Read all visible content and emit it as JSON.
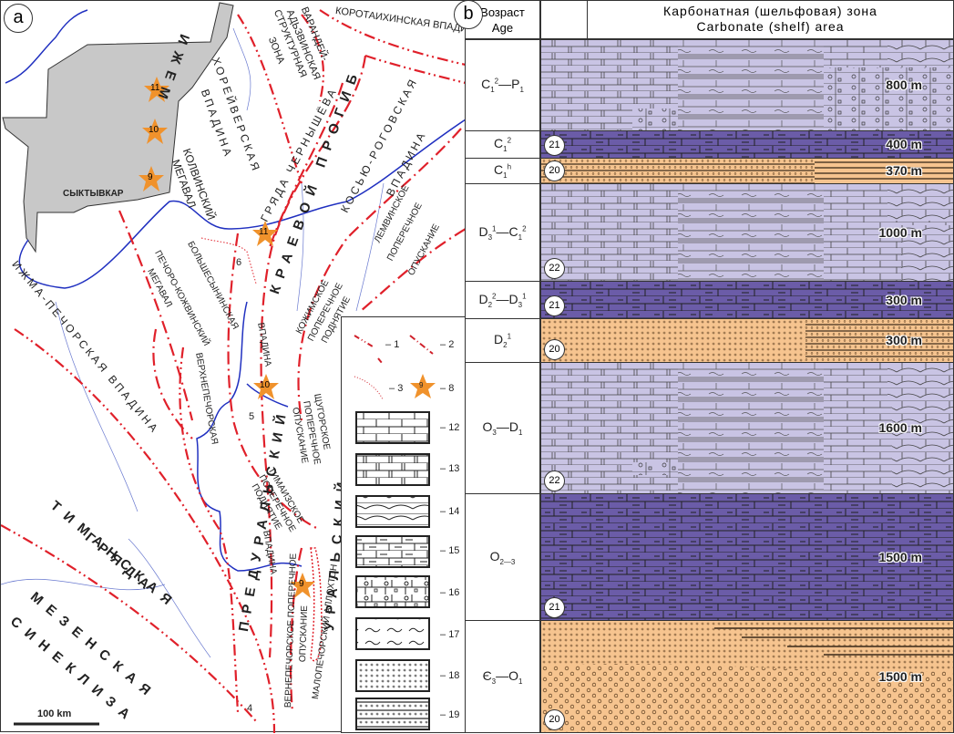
{
  "panel_a": {
    "letter": "a",
    "city": "СЫКТЫВКАР",
    "scale_label": "100 km",
    "stars": [
      "11",
      "10",
      "9",
      "11",
      "10",
      "9"
    ],
    "numbers": [
      "6",
      "5",
      "4"
    ],
    "labels": {
      "korotaikha": "КОРОТАИХИНСКАЯ ВПАДИНА",
      "varandey": "ВАРАНДЕЙ-",
      "adzva": "АДЬЗВИНСКАЯ",
      "struct": "СТРУКТУРНАЯ",
      "zona": "ЗОНА",
      "khoreyver": "ХОРЕЙВЕРСКАЯ",
      "vpadina1": "ВПАДИНА",
      "izhma_letters": "ИЖЕМ",
      "kolva": "КОЛВИНСКИЙ",
      "megaval1": "МЕГАВАЛ",
      "chernyshev": "ГРЯДА ЧЕРНЫШЁВА",
      "kraevoy": "КРАЕВОЙ ПРОГИБ",
      "kosyu": "КОСЬЮ-РОГОВСКАЯ",
      "vpadina2": "ВПАДИНА",
      "lemva": "ЛЕМВИНСКОЕ",
      "poperechnoe1": "ПОПЕРЕЧНОЕ",
      "opuskanie1": "ОПУСКАНИЕ",
      "kozhim": "КОЖИМСКОЕ",
      "poperechnoe2": "ПОПЕРЕЧНОЕ",
      "podnyatie1": "ПОДНЯТИЕ",
      "bolsheshynin": "БОЛЬШЕСЫНИНСКАЯ",
      "vpadina3": "ВПАДИНА",
      "pechoro": "ПЕЧОРО-КОЖВИНСКИЙ",
      "megaval2": "МЕГАВАЛ",
      "izhmapechora": "ИЖМА-ПЕЧОРСКАЯ ВПАДИНА",
      "verkhnepech": "ВЕРХНЕПЕЧОРСКАЯ",
      "preduralsky": "ПРЕДУРАЛЬСКИЙ",
      "uralsky": "УРАЛЬСКИЙ",
      "shchugor": "ЩУГОРСКОЕ",
      "poperechnoe3": "ПОПЕРЕЧНОЕ",
      "opuskanie2": "ОПУСКАНИЕ",
      "timaiz": "ТИМАИЗСКОЕ",
      "poperechnoe4": "ПОПЕРЕЧНОЕ",
      "podnyatie2": "ПОДНЯТИЕ",
      "vpadina4": "ВПАДИНА",
      "verkhnepech2": "ВЕРНЕПЕЧОРСКОЕ ПОПЕРЕЧНОЕ",
      "opuskanie3": "ОПУСКАНИЕ",
      "allochthon": "МАЛОПЕЧОРСКИЙ АЛЛОХТОН",
      "timan": "ТИМАНСКАЯ",
      "gryada": "ГРЯДА",
      "mezen": "МЕЗЕНСКАЯ",
      "sinekliza": "СИНЕКЛИЗА"
    },
    "legend": {
      "items": [
        {
          "num": "1",
          "pattern": "dash-dot-dot red line"
        },
        {
          "num": "2",
          "pattern": "dash-dot red line"
        },
        {
          "num": "3",
          "pattern": "dotted red line"
        },
        {
          "num": "8",
          "pattern": "star",
          "star_label": "9"
        },
        {
          "num": "12",
          "pattern": "limestone"
        },
        {
          "num": "13",
          "pattern": "dolomitic limestone"
        },
        {
          "num": "14",
          "pattern": "reef limestone"
        },
        {
          "num": "15",
          "pattern": "clayey limestone"
        },
        {
          "num": "16",
          "pattern": "breccia limestone"
        },
        {
          "num": "17",
          "pattern": "wavy"
        },
        {
          "num": "18",
          "pattern": "sandstone"
        },
        {
          "num": "19",
          "pattern": "interbedded sandstone"
        }
      ]
    },
    "colors": {
      "region": "#c8c8c8",
      "fault": "#e0202a",
      "river": "#2030c0",
      "star": "#f0922c"
    }
  },
  "panel_b": {
    "letter": "b",
    "age_header": [
      "Возраст",
      "Age"
    ],
    "title": [
      "Карбонатная (шельфовая) зона",
      "Carbonate (shelf) area"
    ],
    "layers": [
      {
        "age_main": "C",
        "age_html": "C<sub>1</sub><sup>2</sup>—P<sub>1</sub>",
        "thickness": "800 m",
        "circle": "",
        "type": "mixed"
      },
      {
        "age_html": "C<sub>1</sub><sup>2</sup>",
        "thickness": "400 m",
        "circle": "21",
        "type": "dark"
      },
      {
        "age_html": "C<sub>1</sub><sup>h</sup>",
        "thickness": "370 m",
        "circle": "20",
        "type": "sand-striped"
      },
      {
        "age_html": "D<sub>3</sub><sup>1</sup>—C<sub>1</sub><sup>2</sup>",
        "thickness": "1000 m",
        "circle": "22",
        "type": "mixed"
      },
      {
        "age_html": "D<sub>2</sub><sup>2</sup>—D<sub>3</sub><sup>1</sup>",
        "thickness": "300 m",
        "circle": "21",
        "type": "dark"
      },
      {
        "age_html": "D<sub>2</sub><sup>1</sup>",
        "thickness": "300 m",
        "circle": "20",
        "type": "sand-right"
      },
      {
        "age_html": "O<sub>3</sub>—D<sub>1</sub>",
        "thickness": "1600 m",
        "circle": "22",
        "type": "mixed"
      },
      {
        "age_html": "O<sub>2—3</sub>",
        "thickness": "1500 m",
        "circle": "21",
        "type": "dark"
      },
      {
        "age_html": "Є<sub>3</sub>—O<sub>1</sub>",
        "thickness": "1500 m",
        "circle": "20",
        "type": "sand-coarse"
      }
    ],
    "colors": {
      "light": "#c9c4e4",
      "dark": "#6b5ca8",
      "sand": "#f6c48f"
    }
  }
}
